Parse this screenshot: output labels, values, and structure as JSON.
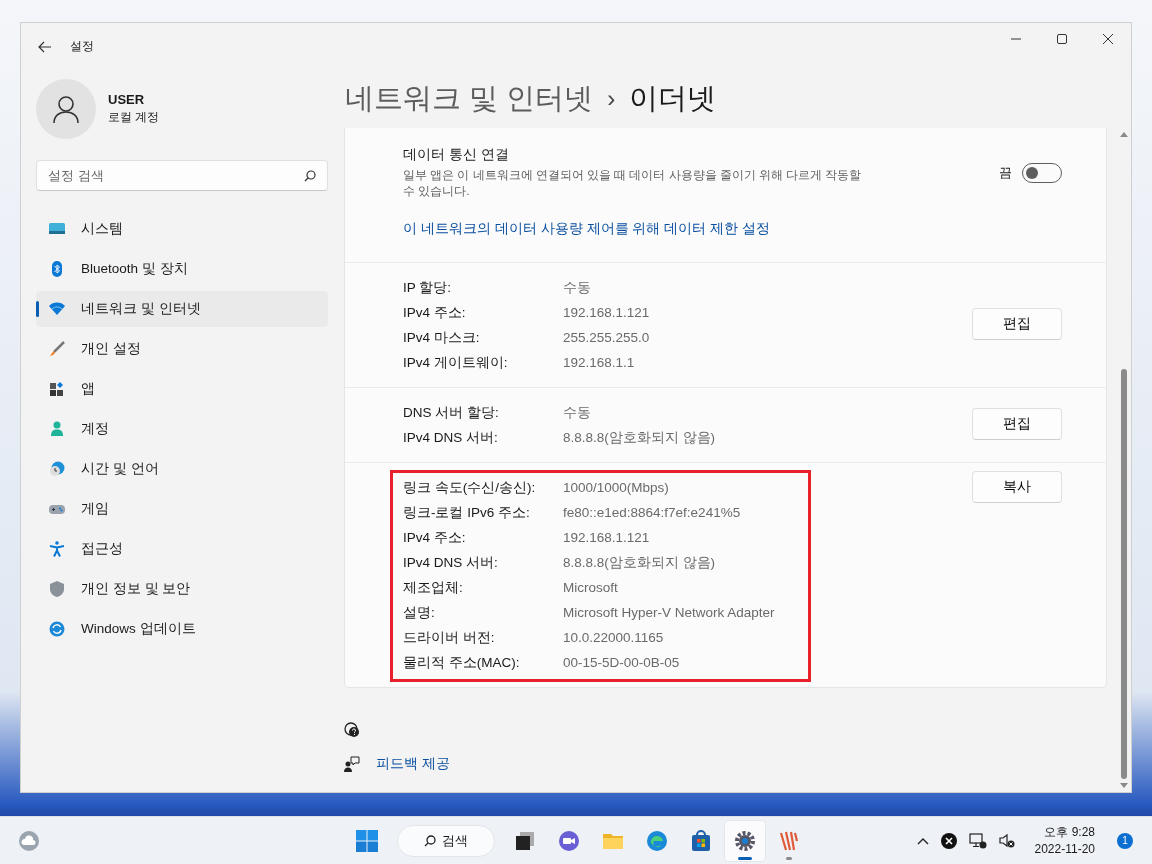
{
  "window": {
    "title": "설정"
  },
  "user": {
    "name": "USER",
    "account": "로컬 계정"
  },
  "search": {
    "placeholder": "설정 검색"
  },
  "nav": [
    {
      "label": "시스템",
      "kind": "system",
      "selected": false
    },
    {
      "label": "Bluetooth 및 장치",
      "kind": "bluetooth",
      "selected": false
    },
    {
      "label": "네트워크 및 인터넷",
      "kind": "network",
      "selected": true
    },
    {
      "label": "개인 설정",
      "kind": "personalization",
      "selected": false
    },
    {
      "label": "앱",
      "kind": "apps",
      "selected": false
    },
    {
      "label": "계정",
      "kind": "accounts",
      "selected": false
    },
    {
      "label": "시간 및 언어",
      "kind": "time",
      "selected": false
    },
    {
      "label": "게임",
      "kind": "gaming",
      "selected": false
    },
    {
      "label": "접근성",
      "kind": "accessibility",
      "selected": false
    },
    {
      "label": "개인 정보 및 보안",
      "kind": "privacy",
      "selected": false
    },
    {
      "label": "Windows 업데이트",
      "kind": "update",
      "selected": false
    }
  ],
  "breadcrumb": {
    "parent": "네트워크 및 인터넷",
    "separator": "›",
    "current": "이더넷"
  },
  "metered": {
    "title": "데이터 통신 연결",
    "description": "일부 앱은 이 네트워크에 연결되어 있을 때 데이터 사용량을 줄이기 위해 다르게 작동할 수 있습니다.",
    "state_label": "끔",
    "on": false,
    "link": "이 네트워크의 데이터 사용량 제어를 위해 데이터 제한 설정"
  },
  "groups": [
    {
      "button": "편집",
      "highlighted": false,
      "rows": [
        {
          "label": "IP 할당:",
          "value": "수동"
        },
        {
          "label": "IPv4 주소:",
          "value": "192.168.1.121"
        },
        {
          "label": "IPv4 마스크:",
          "value": "255.255.255.0"
        },
        {
          "label": "IPv4 게이트웨이:",
          "value": "192.168.1.1"
        }
      ]
    },
    {
      "button": "편집",
      "highlighted": false,
      "rows": [
        {
          "label": "DNS 서버 할당:",
          "value": "수동"
        },
        {
          "label": "IPv4 DNS 서버:",
          "value": "8.8.8.8(암호화되지 않음)"
        }
      ]
    },
    {
      "button": "복사",
      "highlighted": true,
      "rows": [
        {
          "label": "링크 속도(수신/송신):",
          "value": "1000/1000(Mbps)"
        },
        {
          "label": "링크-로컬 IPv6 주소:",
          "value": "fe80::e1ed:8864:f7ef:e241%5"
        },
        {
          "label": "IPv4 주소:",
          "value": "192.168.1.121"
        },
        {
          "label": "IPv4 DNS 서버:",
          "value": "8.8.8.8(암호화되지 않음)"
        },
        {
          "label": "제조업체:",
          "value": "Microsoft"
        },
        {
          "label": "설명:",
          "value": "Microsoft Hyper-V Network Adapter"
        },
        {
          "label": "드라이버 버전:",
          "value": "10.0.22000.1165"
        },
        {
          "label": "물리적 주소(MAC):",
          "value": "00-15-5D-00-0B-05"
        }
      ]
    }
  ],
  "feedback": "피드백 제공",
  "taskbar": {
    "search": "검색",
    "apps": [
      {
        "kind": "taskview",
        "selected": false,
        "running": false
      },
      {
        "kind": "chat",
        "selected": false,
        "running": false
      },
      {
        "kind": "explorer",
        "selected": false,
        "running": false
      },
      {
        "kind": "edge",
        "selected": false,
        "running": false
      },
      {
        "kind": "store",
        "selected": false,
        "running": false
      },
      {
        "kind": "settings",
        "selected": true,
        "running": true
      },
      {
        "kind": "app",
        "selected": false,
        "running": true
      }
    ],
    "time": "오후 9:28",
    "date": "2022-11-20",
    "notifications": "1"
  }
}
